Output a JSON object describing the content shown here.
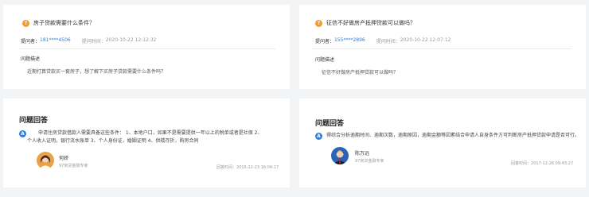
{
  "left": {
    "question": {
      "icon": "question-icon",
      "title": "房子贷款需要什么条件？",
      "asker_label": "提问者：",
      "asker_phone": "181****4506",
      "time_label": "提问时间：",
      "time_value": "2020-10-22 12:12:32",
      "desc_label": "问题描述",
      "desc_text": "近期打算贷款买一套房子，想了解下买房子贷款需要什么条件吗？"
    },
    "answer": {
      "section_title": "问题回答",
      "icon": "answer-icon",
      "line1": "申请住房贷款借款人需要具备这些条件：    1、本地户口，如果不是需要提供一年以上的税单或者是社保        2、",
      "line2": "个人收入证明，银行流水账单        3、个人身份证，婚姻证明        4、供楼存折，购房合同",
      "expert_name": "何娇",
      "expert_title": "97房贷金融专家",
      "reply_label": "回答时间：",
      "reply_time": "2015-12-23 16:04:17"
    }
  },
  "right": {
    "question": {
      "icon": "question-icon",
      "title": "征信不好做房产抵押贷款可以做吗？",
      "asker_label": "提问者：",
      "asker_phone": "155****2896",
      "time_label": "提问时间：",
      "time_value": "2020-10-22 12:07:12",
      "desc_label": "问题描述",
      "desc_text": "征信不好做房产抵押贷款可以做吗？"
    },
    "answer": {
      "section_title": "问题回答",
      "icon": "answer-icon",
      "line1": "得综合分析逾期时间、逾期次数，逾期原因，逾期金额等因素结合申请人自身条件方可判断房产抵押贷款申请是否可行。",
      "expert_name": "陈万远",
      "expert_title": "97房贷金融专家",
      "reply_label": "回答时间：",
      "reply_time": "2017-12-26 09:43:27"
    }
  },
  "colors": {
    "question_icon": "#f39a2b",
    "answer_icon": "#2f7fd6",
    "phone_link": "#2f7fd6",
    "page_bg": "#f2f3f5"
  }
}
